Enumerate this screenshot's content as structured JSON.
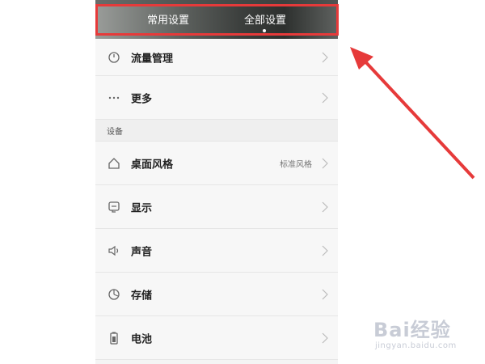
{
  "header": {
    "tabs": [
      {
        "label": "常用设置"
      },
      {
        "label": "全部设置"
      }
    ]
  },
  "rows_top": [
    {
      "label": "流量管理",
      "icon": "traffic-icon"
    },
    {
      "label": "更多",
      "icon": "more-dots-icon"
    }
  ],
  "section_device": {
    "title": "设备"
  },
  "rows_device": [
    {
      "label": "桌面风格",
      "value": "标准风格",
      "icon": "home-icon"
    },
    {
      "label": "显示",
      "icon": "display-icon"
    },
    {
      "label": "声音",
      "icon": "speaker-icon"
    },
    {
      "label": "存储",
      "icon": "storage-icon"
    },
    {
      "label": "电池",
      "icon": "battery-icon"
    }
  ],
  "annotation": {
    "highlight_color": "#e63a3a"
  },
  "watermark": {
    "main": "Bai经验",
    "sub": "jingyan.baidu.com"
  }
}
